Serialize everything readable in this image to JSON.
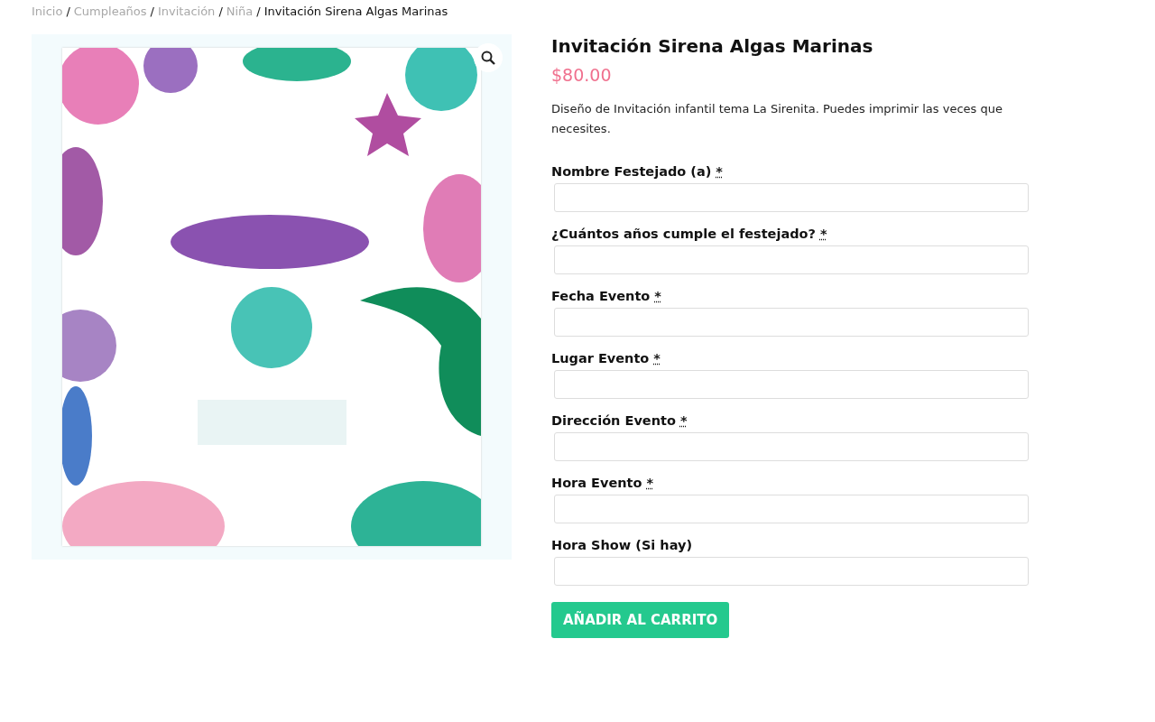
{
  "breadcrumb": [
    {
      "label": "Inicio",
      "current": false,
      "separator": "/"
    },
    {
      "label": "Cumpleaños",
      "current": false,
      "separator": "/"
    },
    {
      "label": "Invitación",
      "current": false,
      "separator": "/"
    },
    {
      "label": "Niña",
      "current": false,
      "separator": "/"
    },
    {
      "label": "Invitación Sirena Algas Marinas",
      "current": true
    }
  ],
  "product": {
    "title": "Invitación Sirena Algas Marinas",
    "price": "$80.00",
    "description": "Diseño de Invitación infantil tema La Sirenita. Puedes imprimir las veces que necesites.",
    "fields": [
      {
        "label": "Nombre Festejado (a)",
        "required_mark": "*"
      },
      {
        "label": "¿Cuántos años cumple el festejado?",
        "required_mark": "*"
      },
      {
        "label": "Fecha Evento",
        "required_mark": "*"
      },
      {
        "label": "Lugar Evento",
        "required_mark": "*"
      },
      {
        "label": "Dirección Evento",
        "required_mark": "*"
      },
      {
        "label": "Hora Evento",
        "required_mark": "*"
      },
      {
        "label": "Hora Show (Si hay)"
      }
    ],
    "button": "AÑADIR AL CARRITO"
  }
}
